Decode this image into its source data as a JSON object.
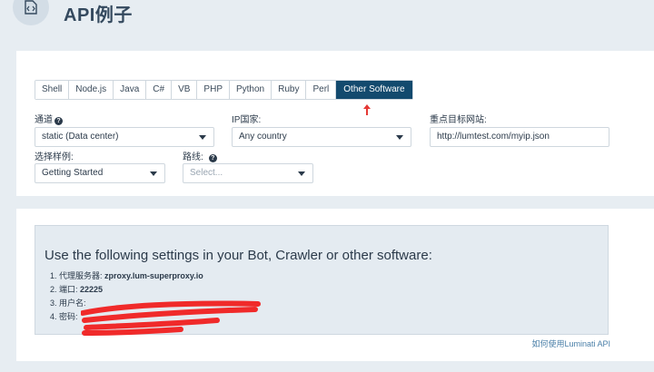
{
  "header": {
    "title": "API例子",
    "icon": "code-file-icon"
  },
  "tabs": [
    {
      "label": "Shell",
      "active": false
    },
    {
      "label": "Node.js",
      "active": false
    },
    {
      "label": "Java",
      "active": false
    },
    {
      "label": "C#",
      "active": false
    },
    {
      "label": "VB",
      "active": false
    },
    {
      "label": "PHP",
      "active": false
    },
    {
      "label": "Python",
      "active": false
    },
    {
      "label": "Ruby",
      "active": false
    },
    {
      "label": "Perl",
      "active": false
    },
    {
      "label": "Other Software",
      "active": true
    }
  ],
  "form": {
    "channel_label": "通道",
    "channel_value": "static (Data center)",
    "ip_country_label": "IP国家:",
    "ip_country_value": "Any country",
    "target_site_label": "重点目标网站:",
    "target_site_value": "http://lumtest.com/myip.json",
    "sample_label": "选择样例:",
    "sample_value": "Getting Started",
    "route_label": "路线:",
    "route_placeholder": "Select..."
  },
  "settings": {
    "title": "Use the following settings in your Bot, Crawler or other software:",
    "items": [
      {
        "label": "1. 代理服务器: ",
        "value": "zproxy.lum-superproxy.io"
      },
      {
        "label": "2. 端口: ",
        "value": "22225"
      },
      {
        "label": "3. 用户名: ",
        "value": ""
      },
      {
        "label": "4. 密码: ",
        "value": ""
      }
    ]
  },
  "footer": {
    "link": "如何使用Luminati API"
  },
  "colors": {
    "active_tab": "#134a6e",
    "background": "#e7edf2",
    "link": "#4a7fa8",
    "arrow": "#e53935",
    "redaction": "#f02a2a"
  }
}
